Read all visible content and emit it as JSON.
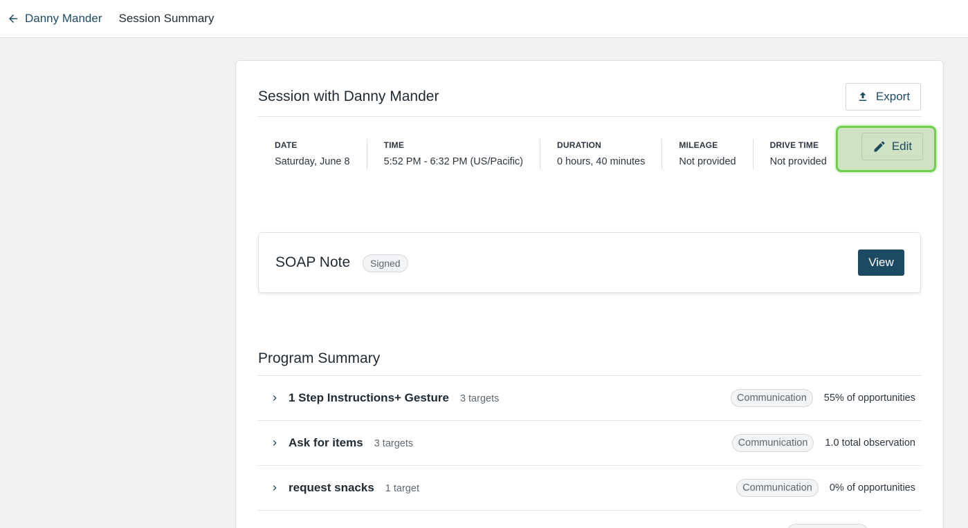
{
  "header": {
    "back_label": "Danny Mander",
    "page_title": "Session Summary"
  },
  "session": {
    "title": "Session with Danny Mander",
    "export_label": "Export",
    "edit_label": "Edit",
    "meta": [
      {
        "label": "DATE",
        "value": "Saturday, June 8"
      },
      {
        "label": "TIME",
        "value": "5:52 PM - 6:32 PM (US/Pacific)"
      },
      {
        "label": "DURATION",
        "value": "0 hours, 40 minutes"
      },
      {
        "label": "MILEAGE",
        "value": "Not provided"
      },
      {
        "label": "DRIVE TIME",
        "value": "Not provided"
      }
    ]
  },
  "soap": {
    "title": "SOAP Note",
    "status": "Signed",
    "view_label": "View"
  },
  "program_summary": {
    "title": "Program Summary",
    "programs": [
      {
        "name": "1 Step Instructions+ Gesture",
        "targets": "3 targets",
        "tag": "Communication",
        "stat": "55% of opportunities"
      },
      {
        "name": "Ask for items",
        "targets": "3 targets",
        "tag": "Communication",
        "stat": "1.0 total observation"
      },
      {
        "name": "request snacks",
        "targets": "1 target",
        "tag": "Communication",
        "stat": "0% of opportunities"
      }
    ]
  },
  "colors": {
    "primary": "#1d4a63",
    "highlight_border": "#6ed04a",
    "highlight_fill": "#cfe3c4"
  }
}
